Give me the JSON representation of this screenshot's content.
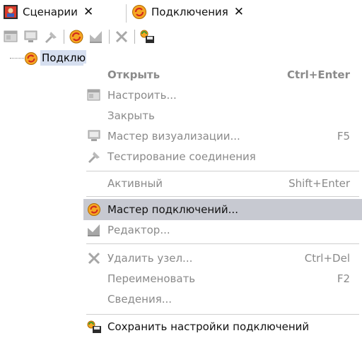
{
  "tabs": [
    {
      "label": "Сценарии",
      "close": "✕",
      "icon": "scenarios-icon"
    },
    {
      "label": "Подключения",
      "close": "✕",
      "icon": "connections-icon"
    }
  ],
  "toolbar": {
    "buttons": [
      "configure-icon",
      "visualization-icon",
      "test-connection-icon",
      "connection-wizard-icon",
      "editor-icon",
      "delete-icon",
      "save-settings-icon"
    ]
  },
  "tree": {
    "node_label": "Подключения"
  },
  "menu": {
    "open": {
      "label": "Открыть",
      "shortcut": "Ctrl+Enter"
    },
    "configure": {
      "label": "Настроить..."
    },
    "close": {
      "label": "Закрыть"
    },
    "viz_wizard": {
      "label": "Мастер визуализации...",
      "shortcut": "F5"
    },
    "test_connection": {
      "label": "Тестирование соединения"
    },
    "active": {
      "label": "Активный",
      "shortcut": "Shift+Enter"
    },
    "connection_wizard": {
      "label": "Мастер подключений..."
    },
    "editor": {
      "label": "Редактор..."
    },
    "delete_node": {
      "label": "Удалить узел...",
      "shortcut": "Ctrl+Del"
    },
    "rename": {
      "label": "Переименовать",
      "shortcut": "F2"
    },
    "info": {
      "label": "Сведения..."
    },
    "save_settings": {
      "label": "Сохранить настройки подключений"
    }
  },
  "colors": {
    "highlight": "#c7c9d1",
    "disabled_text": "#8a8a8a",
    "connection_orange": "#f5a623",
    "connection_red": "#d0281e",
    "tree_selection": "#d6dff0"
  }
}
